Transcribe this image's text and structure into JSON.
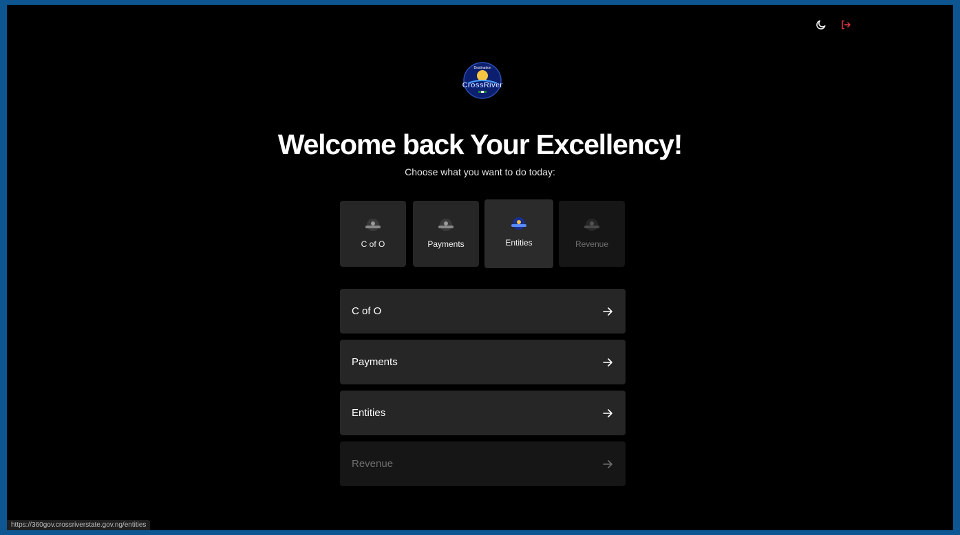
{
  "header": {
    "theme_toggle_icon": "moon-icon",
    "logout_icon": "logout-icon",
    "logout_color": "#e53946"
  },
  "logo": {
    "text_top": "Destination",
    "text_main": "CrossRiver"
  },
  "welcome": {
    "title": "Welcome back Your Excellency!",
    "subtitle": "Choose what you want to do today:"
  },
  "tiles": [
    {
      "label": "C of O",
      "state": "normal"
    },
    {
      "label": "Payments",
      "state": "normal"
    },
    {
      "label": "Entities",
      "state": "active"
    },
    {
      "label": "Revenue",
      "state": "disabled"
    }
  ],
  "menu": [
    {
      "label": "C of O",
      "state": "normal"
    },
    {
      "label": "Payments",
      "state": "normal"
    },
    {
      "label": "Entities",
      "state": "normal"
    },
    {
      "label": "Revenue",
      "state": "disabled"
    }
  ],
  "status_bar": {
    "url": "https://360gov.crossriverstate.gov.ng/entities"
  }
}
